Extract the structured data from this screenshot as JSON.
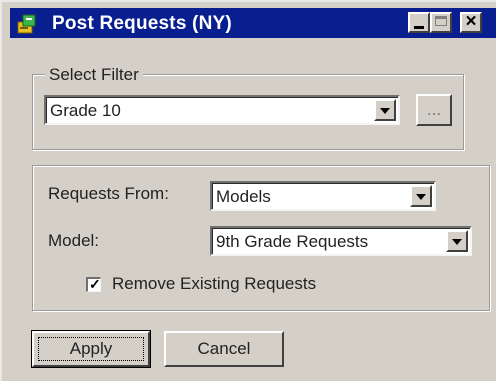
{
  "window": {
    "title": "Post Requests (NY)",
    "controls": {
      "minimize": "minimize",
      "maximize": "maximize",
      "close": "×"
    }
  },
  "select_filter": {
    "legend": "Select Filter",
    "value": "Grade 10",
    "browse_label": "..."
  },
  "requests": {
    "from_label": "Requests From:",
    "from_value": "Models",
    "model_label": "Model:",
    "model_value": "9th Grade Requests",
    "remove_existing_label": "Remove Existing Requests",
    "remove_existing_checked": true
  },
  "buttons": {
    "apply": "Apply",
    "cancel": "Cancel"
  }
}
